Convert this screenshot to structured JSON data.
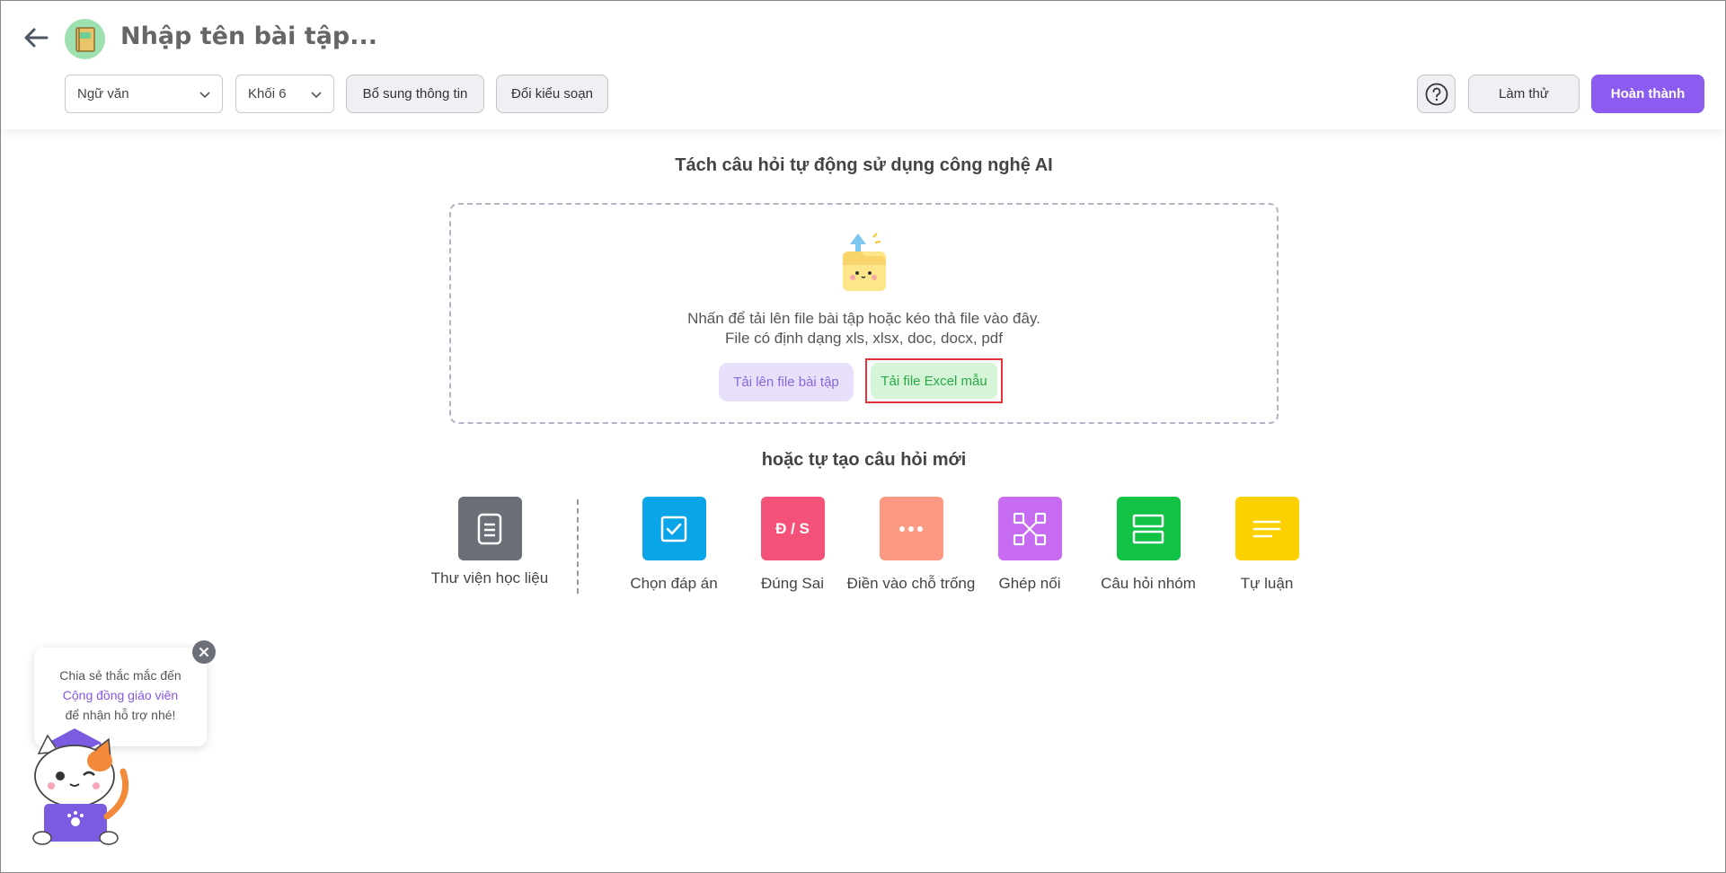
{
  "header": {
    "title": "Nhập tên bài tập...",
    "subject_value": "Ngữ văn",
    "grade_value": "Khối 6",
    "add_info_label": "Bổ sung thông tin",
    "change_mode_label": "Đổi kiểu soạn",
    "try_label": "Làm thử",
    "finish_label": "Hoàn thành"
  },
  "ai_section": {
    "title": "Tách câu hỏi tự động sử dụng công nghệ AI",
    "instruction": "Nhấn để tải lên file bài tập hoặc kéo thả file vào đây.",
    "formats": "File có định dạng xls, xlsx, doc, docx, pdf",
    "upload_label": "Tải lên file bài tập",
    "excel_label": "Tải file Excel mẫu"
  },
  "create_section": {
    "title": "hoặc tự tạo câu hỏi mới",
    "library": {
      "label": "Thư viện học liệu",
      "icon": "document-icon",
      "color": "#6b6f78"
    },
    "types": [
      {
        "label": "Chọn đáp án",
        "icon": "checkbox-icon",
        "color": "#0aa4e8"
      },
      {
        "label": "Đúng Sai",
        "icon_text": "Đ / S",
        "icon": "true-false-icon",
        "color": "#f5527a"
      },
      {
        "label": "Điền vào chỗ trống",
        "icon": "dots-icon",
        "color": "#fb9982"
      },
      {
        "label": "Ghép nối",
        "icon": "match-icon",
        "color": "#c76bf2"
      },
      {
        "label": "Câu hỏi nhóm",
        "icon": "group-icon",
        "color": "#11c245"
      },
      {
        "label": "Tự luận",
        "icon": "lines-icon",
        "color": "#fdd000"
      }
    ]
  },
  "support": {
    "line1": "Chia sẻ thắc mắc đến",
    "link": "Cộng đồng giáo viên",
    "line3": "để nhận hỗ trợ nhé!"
  }
}
